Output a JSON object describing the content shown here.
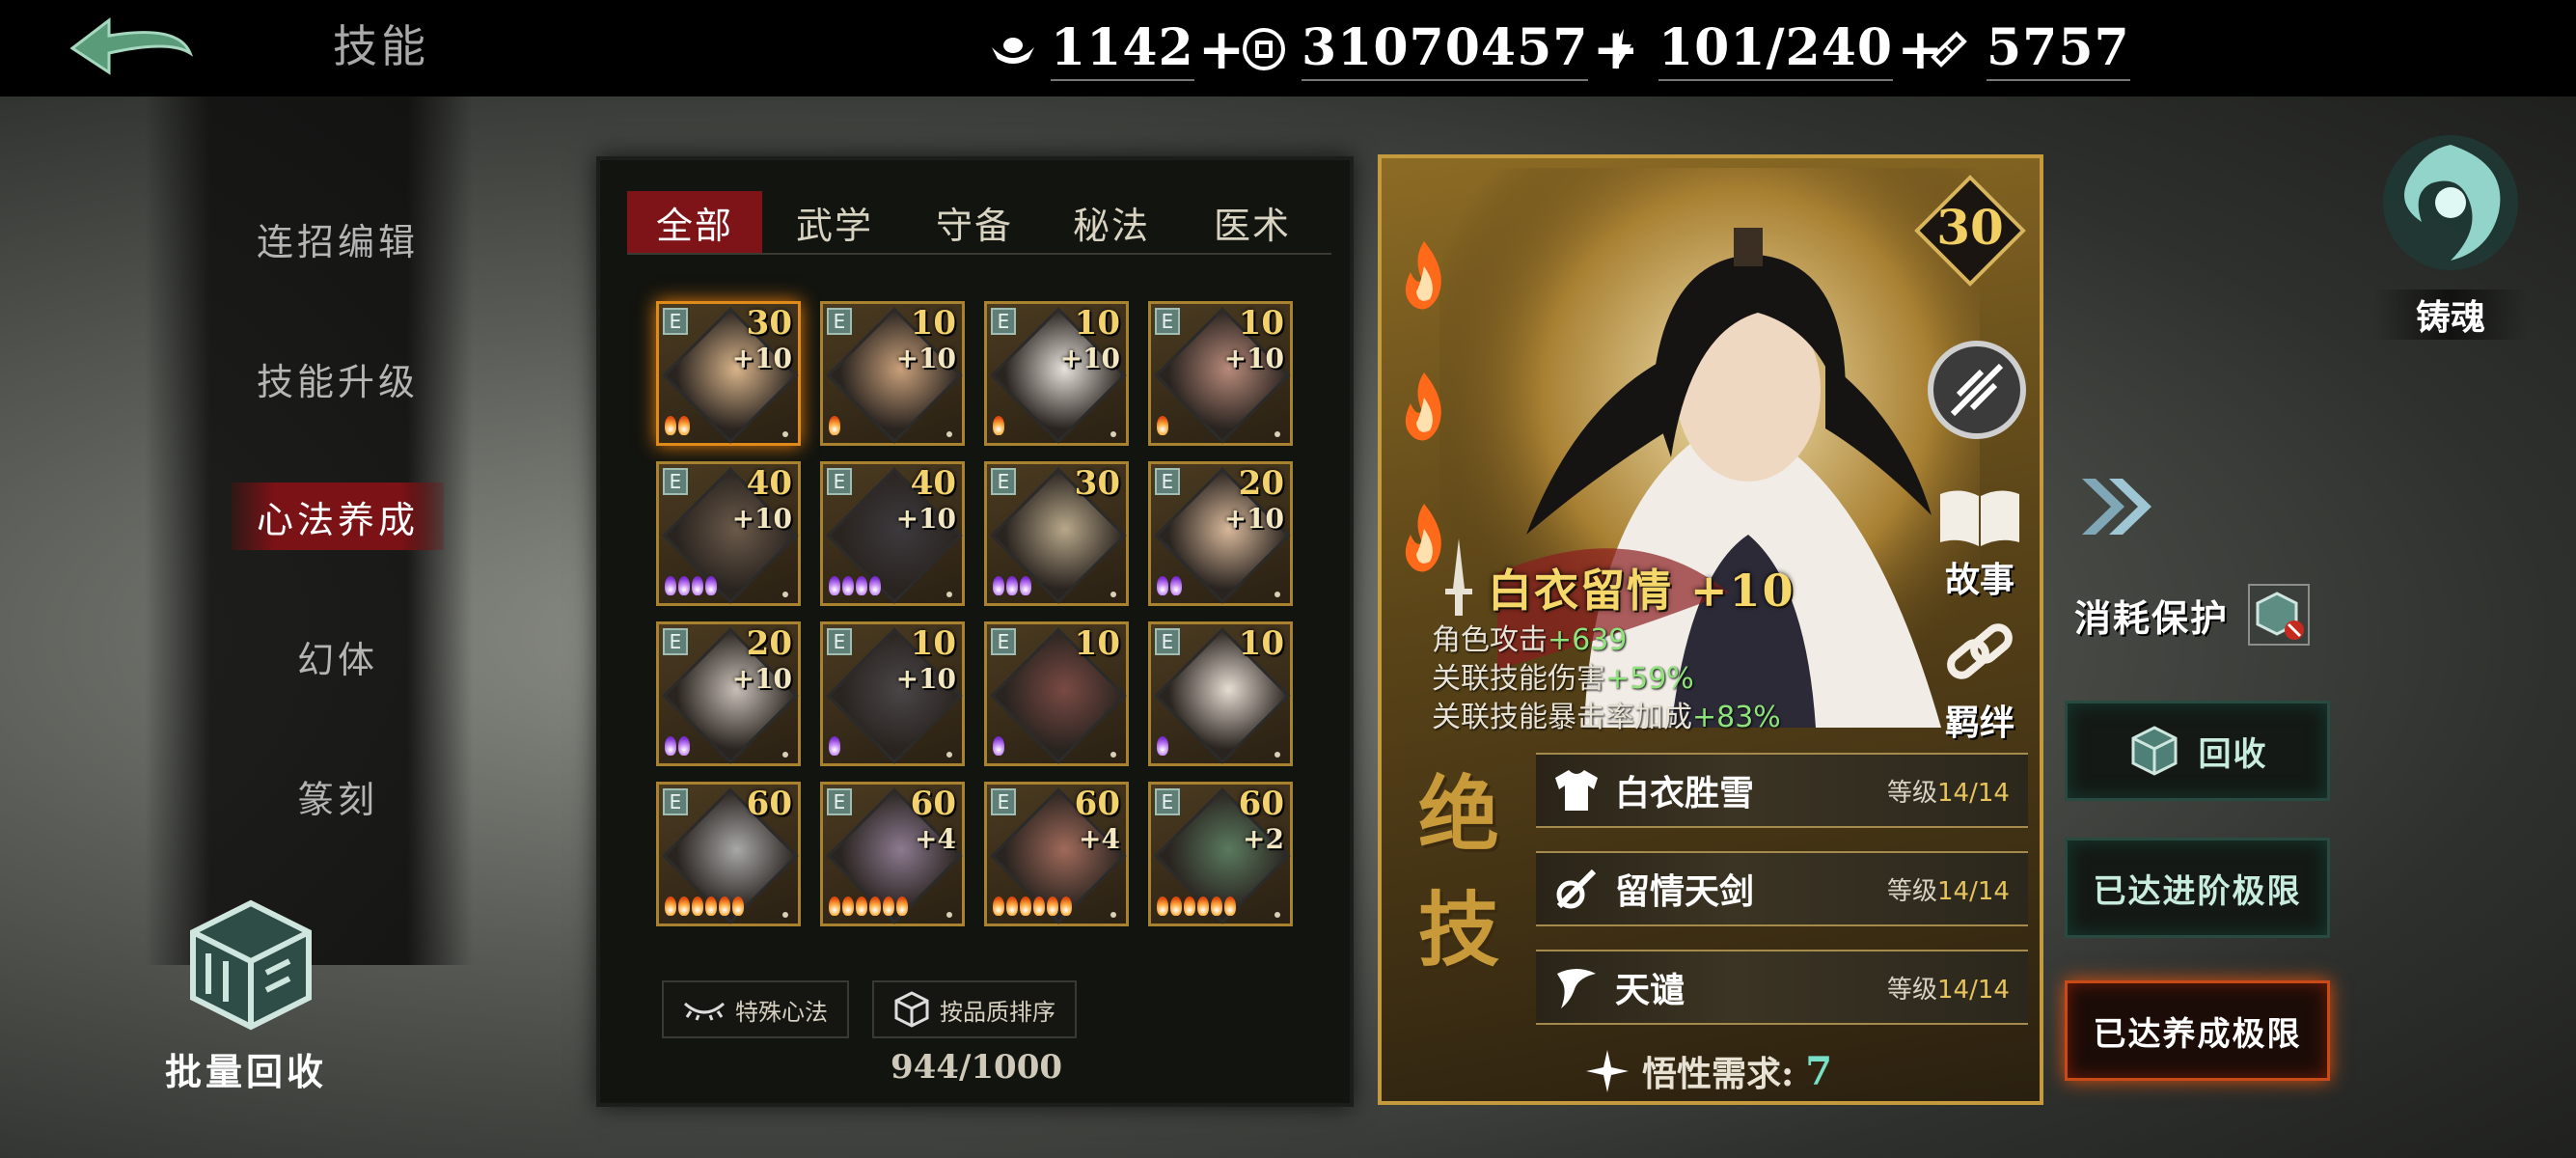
{
  "topbar": {
    "title": "技能",
    "resources": [
      {
        "icon": "ingot-icon",
        "value": "1142"
      },
      {
        "icon": "coin-icon",
        "value": "31070457"
      },
      {
        "icon": "lightning-icon",
        "value": "101/240"
      },
      {
        "icon": "ticket-icon",
        "value": "5757"
      }
    ],
    "plus": "+"
  },
  "leftnav": {
    "items": [
      "连招编辑",
      "技能升级",
      "心法养成",
      "幻体",
      "篆刻"
    ],
    "active_index": 2,
    "batch_label": "批量回收"
  },
  "tabs": [
    "全部",
    "武学",
    "守备",
    "秘法",
    "医术"
  ],
  "grid": {
    "cards": [
      {
        "level": "30",
        "plus": "+10",
        "flames": 2,
        "flame_color": "orange",
        "selected": true
      },
      {
        "level": "10",
        "plus": "+10",
        "flames": 1,
        "flame_color": "orange"
      },
      {
        "level": "10",
        "plus": "+10",
        "flames": 1,
        "flame_color": "orange"
      },
      {
        "level": "10",
        "plus": "+10",
        "flames": 1,
        "flame_color": "orange"
      },
      {
        "level": "40",
        "plus": "+10",
        "flames": 4,
        "flame_color": "purple"
      },
      {
        "level": "40",
        "plus": "+10",
        "flames": 4,
        "flame_color": "purple"
      },
      {
        "level": "30",
        "plus": "",
        "flames": 3,
        "flame_color": "purple"
      },
      {
        "level": "20",
        "plus": "+10",
        "flames": 2,
        "flame_color": "purple"
      },
      {
        "level": "20",
        "plus": "+10",
        "flames": 2,
        "flame_color": "purple"
      },
      {
        "level": "10",
        "plus": "+10",
        "flames": 1,
        "flame_color": "purple"
      },
      {
        "level": "10",
        "plus": "",
        "flames": 1,
        "flame_color": "purple"
      },
      {
        "level": "10",
        "plus": "",
        "flames": 1,
        "flame_color": "purple"
      },
      {
        "level": "60",
        "plus": "",
        "flames": 6,
        "flame_color": "orange"
      },
      {
        "level": "60",
        "plus": "+4",
        "flames": 6,
        "flame_color": "orange"
      },
      {
        "level": "60",
        "plus": "+4",
        "flames": 6,
        "flame_color": "orange"
      },
      {
        "level": "60",
        "plus": "+2",
        "flames": 6,
        "flame_color": "orange"
      }
    ],
    "buttons": {
      "special": "特殊心法",
      "sort": "按品质排序"
    },
    "capacity": "944/1000"
  },
  "detail": {
    "level": "30",
    "name": "白衣留情 +10",
    "stats": [
      {
        "label": "角色攻击",
        "value": "+639"
      },
      {
        "label": "关联技能伤害",
        "value": "+59%"
      },
      {
        "label": "关联技能暴击率加成",
        "value": "+83%"
      }
    ],
    "story": "故事",
    "bond": "羁绊",
    "juexue": [
      "绝",
      "技"
    ],
    "skills": [
      {
        "name": "白衣胜雪",
        "level_label": "等级",
        "level": "14/14"
      },
      {
        "name": "留情天剑",
        "level_label": "等级",
        "level": "14/14"
      },
      {
        "name": "天谴",
        "level_label": "等级",
        "level": "14/14"
      }
    ],
    "wuxing_label": "悟性需求:",
    "wuxing_value": "7"
  },
  "right": {
    "soul": "铸魂",
    "protect": "消耗保护",
    "recycle": "回收",
    "advance_max": "已达进阶极限",
    "cultivate_max": "已达养成极限"
  },
  "colors": {
    "accent_red": "#7e1418",
    "gold": "#f3d26b",
    "green_stat": "#8ee37a",
    "teal": "#77e0c7"
  }
}
